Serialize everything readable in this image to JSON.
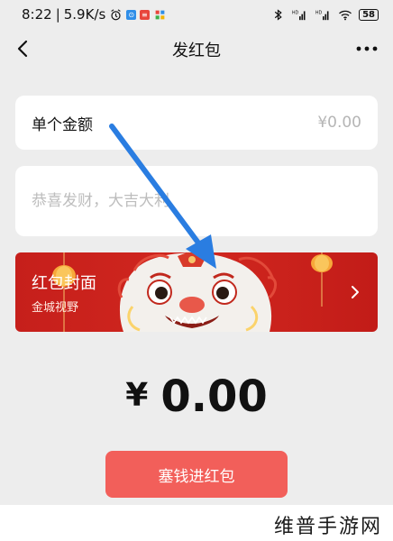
{
  "status_bar": {
    "time": "8:22",
    "speed": "5.9K/s",
    "battery": "58",
    "icons": [
      "alarm-icon",
      "app-badge-icon",
      "app-badge-icon",
      "app-grid-icon",
      "bluetooth-icon",
      "signal-hd-icon",
      "signal-hd-icon",
      "wifi-icon",
      "battery-icon"
    ],
    "badge_colors": [
      "#2f8ee8",
      "#e8453c",
      "#f2b400"
    ]
  },
  "nav": {
    "title": "发红包",
    "back_icon": "chevron-left-icon",
    "more_icon": "more-dots-icon"
  },
  "amount_field": {
    "label": "单个金额",
    "value": "¥0.00"
  },
  "greeting_field": {
    "placeholder": "恭喜发财，大吉大利"
  },
  "cover": {
    "title": "红包封面",
    "subtitle": "金城视野",
    "chevron_icon": "chevron-right-icon",
    "art": "lion-dance-head",
    "background": "#c61f1b"
  },
  "total": {
    "currency": "¥",
    "amount": "0.00"
  },
  "submit": {
    "label": "塞钱进红包",
    "color": "#f25f5a"
  },
  "watermark": {
    "text": "维普手游网"
  },
  "annotation": {
    "type": "arrow",
    "color": "#2a7de1"
  }
}
